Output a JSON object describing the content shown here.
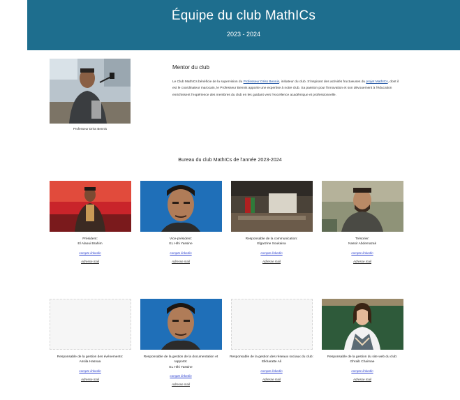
{
  "header": {
    "title": "Équipe du club MathICs",
    "year": "2023 - 2024"
  },
  "mentor": {
    "section_title": "Mentor du club",
    "caption": "Professeur Driss Bennis",
    "text_1": "Le Club MathICs bénéficie de la supervision du ",
    "link_1": "Professeur Driss Bennis",
    "text_2": ", initiateur du club. S'inspirant des activités fructueuses du ",
    "link_2": "projet MathICs",
    "text_3": ", dont il est le coordinateur marocain, le Professeur Bennis apporte une expertise à notre club. Sa passion pour l'innovation et son dévouement à l'éducation enrichissent l'expérience des membres du club en les guidant vers l'excellence académique et professionnelle."
  },
  "bureau": {
    "title": "Bureau du club MathICs de l'année 2023-2024",
    "link_label": "compte linkedin",
    "email_label": "Adresse mail",
    "members": [
      {
        "role": "Président:",
        "name": "El Alaoui Brahim"
      },
      {
        "role": "Vice-président:",
        "name": "EL Hihi Yassine"
      },
      {
        "role": "Responsable de la communication:",
        "name": "Elgarzine Soukaina"
      },
      {
        "role": "Trésorier:",
        "name": "Nassir Abdemazak"
      },
      {
        "role": "Responsable de la gestion des événements:",
        "name": "Assila Hasnaa"
      },
      {
        "role": "Responsable de la gestion de la documentation et rapports:",
        "name": "EL Hihi Yassine"
      },
      {
        "role": "Responsable de la gestion des réseaux sociaux du club:",
        "name": "Elkharatte Ali"
      },
      {
        "role": "Responsable de la gestion du site web du club:",
        "name": "Ghraib Chaimae"
      }
    ]
  }
}
